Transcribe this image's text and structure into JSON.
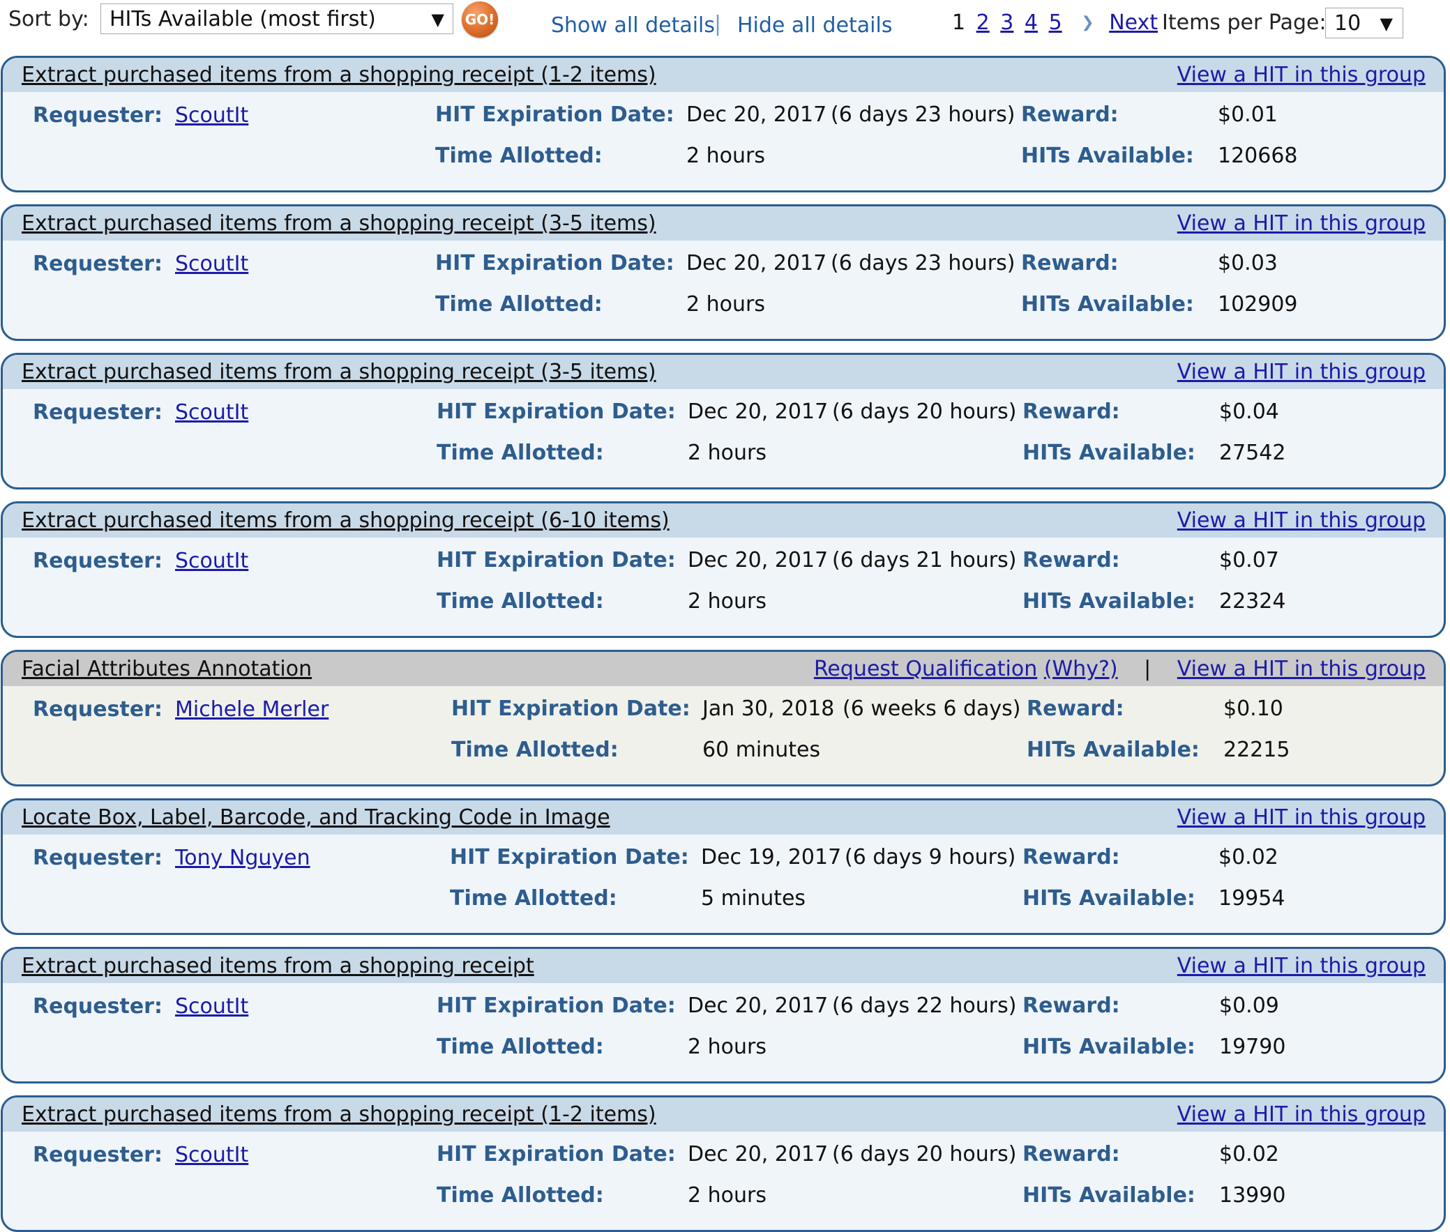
{
  "toolbar": {
    "sort_label": "Sort by:",
    "sort_value": "HITs Available (most first)",
    "go_label": "GO!",
    "show_all_details": "Show all details",
    "divider": "|",
    "hide_all_details": "Hide all details",
    "current_page": "1",
    "pages": [
      "2",
      "3",
      "4",
      "5"
    ],
    "next_label": "Next",
    "per_page_label": "Items per Page:",
    "per_page_value": "10"
  },
  "labels": {
    "requester": "Requester:",
    "expiration": "HIT Expiration Date:",
    "time_allotted": "Time Allotted:",
    "reward": "Reward:",
    "hits_available": "HITs Available:",
    "view_hit": "View a HIT in this group",
    "request_qualification": "Request Qualification",
    "why": "(Why?)",
    "pipe": "|"
  },
  "hits": [
    {
      "title": "Extract purchased items from a shopping receipt (1-2 items)",
      "requester": "ScoutIt",
      "expiration": "Dec 20, 2017",
      "remaining": "(6 days 23 hours)",
      "time_allotted": "2 hours",
      "reward": "$0.01",
      "hits_available": "120668",
      "qualification_required": false
    },
    {
      "title": "Extract purchased items from a shopping receipt (3-5 items)",
      "requester": "ScoutIt",
      "expiration": "Dec 20, 2017",
      "remaining": "(6 days 23 hours)",
      "time_allotted": "2 hours",
      "reward": "$0.03",
      "hits_available": "102909",
      "qualification_required": false
    },
    {
      "title": "Extract purchased items from a shopping receipt (3-5 items)",
      "requester": "ScoutIt",
      "expiration": "Dec 20, 2017",
      "remaining": "(6 days 20 hours)",
      "time_allotted": "2 hours",
      "reward": "$0.04",
      "hits_available": "27542",
      "qualification_required": false
    },
    {
      "title": "Extract purchased items from a shopping receipt (6-10 items)",
      "requester": "ScoutIt",
      "expiration": "Dec 20, 2017",
      "remaining": "(6 days 21 hours)",
      "time_allotted": "2 hours",
      "reward": "$0.07",
      "hits_available": "22324",
      "qualification_required": false
    },
    {
      "title": "Facial Attributes Annotation",
      "requester": "Michele Merler",
      "expiration": "Jan 30, 2018",
      "remaining": "(6 weeks 6 days)",
      "time_allotted": "60 minutes",
      "reward": "$0.10",
      "hits_available": "22215",
      "qualification_required": true
    },
    {
      "title": "Locate Box, Label, Barcode, and Tracking Code in Image",
      "requester": "Tony Nguyen",
      "expiration": "Dec 19, 2017",
      "remaining": "(6 days 9 hours)",
      "time_allotted": "5 minutes",
      "reward": "$0.02",
      "hits_available": "19954",
      "qualification_required": false
    },
    {
      "title": "Extract purchased items from a shopping receipt",
      "requester": "ScoutIt",
      "expiration": "Dec 20, 2017",
      "remaining": "(6 days 22 hours)",
      "time_allotted": "2 hours",
      "reward": "$0.09",
      "hits_available": "19790",
      "qualification_required": false
    },
    {
      "title": "Extract purchased items from a shopping receipt (1-2 items)",
      "requester": "ScoutIt",
      "expiration": "Dec 20, 2017",
      "remaining": "(6 days 20 hours)",
      "time_allotted": "2 hours",
      "reward": "$0.02",
      "hits_available": "13990",
      "qualification_required": false
    }
  ]
}
